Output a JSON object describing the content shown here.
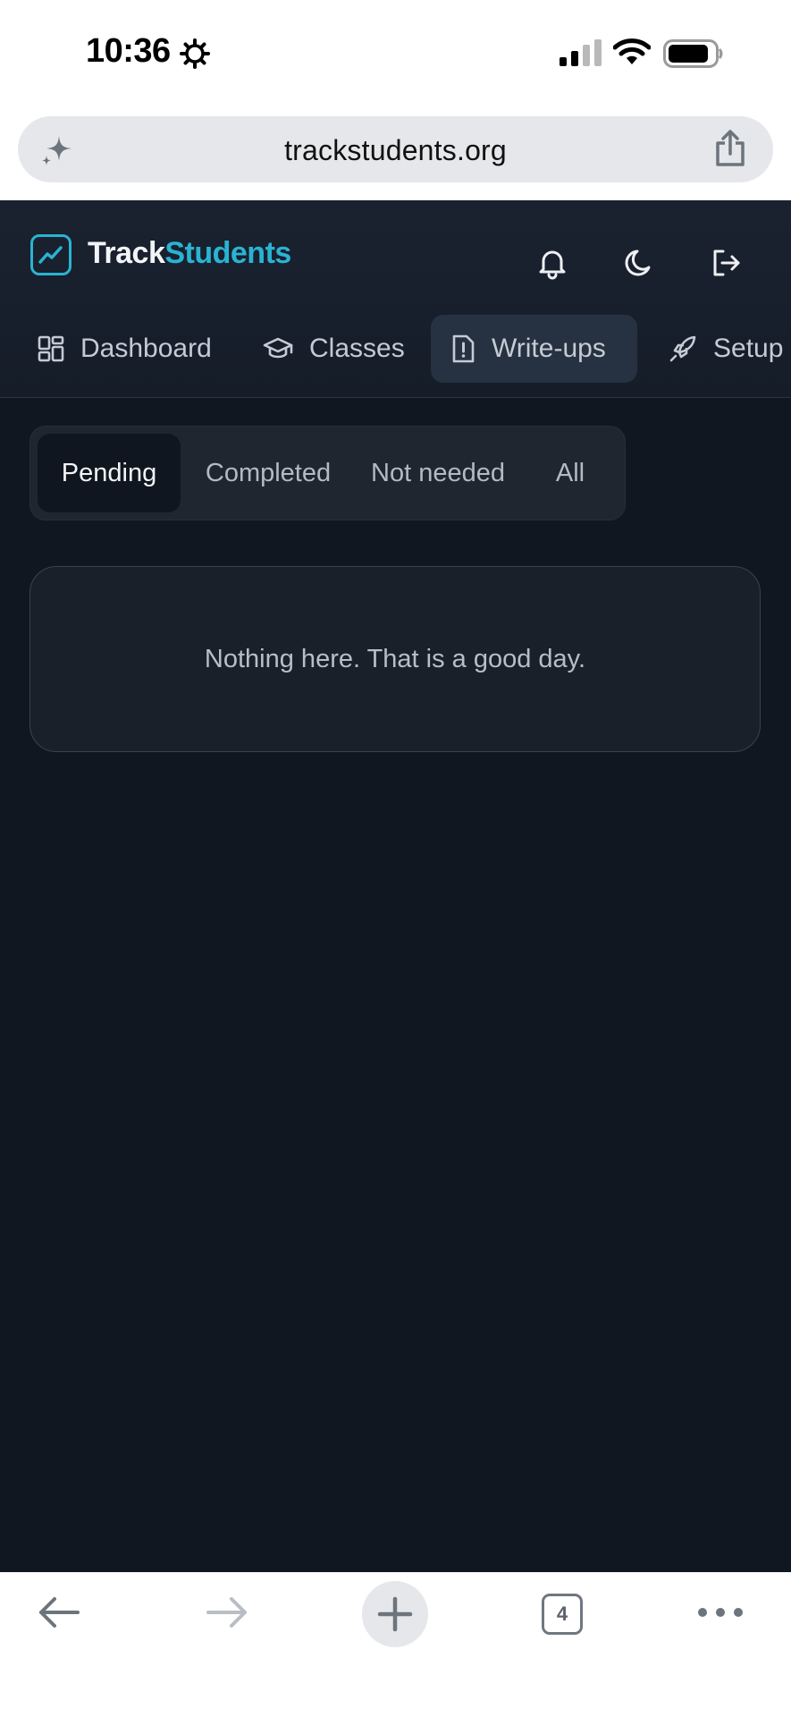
{
  "status_bar": {
    "time": "10:36",
    "icons": [
      "gear-icon",
      "signal-icon",
      "wifi-icon",
      "battery-icon"
    ]
  },
  "browser": {
    "url": "trackstudents.org",
    "icons": [
      "sparkle-icon",
      "share-icon"
    ]
  },
  "app": {
    "brand_part1": "Track",
    "brand_part2": "Students",
    "accent_color": "#2ab3d3",
    "header_icons": [
      "bell-icon",
      "moon-icon",
      "logout-icon"
    ],
    "nav": [
      {
        "label": "Dashboard",
        "icon": "grid-icon",
        "active": false
      },
      {
        "label": "Classes",
        "icon": "graduation-cap-icon",
        "active": false
      },
      {
        "label": "Write-ups",
        "icon": "alert-file-icon",
        "active": true
      },
      {
        "label": "Setup",
        "icon": "rocket-icon",
        "active": false
      }
    ]
  },
  "filters": {
    "tabs": [
      "Pending",
      "Completed",
      "Not needed",
      "All"
    ],
    "selected": "Pending"
  },
  "empty_state": {
    "message": "Nothing here. That is a good day."
  },
  "toolbar": {
    "tab_count": "4",
    "icons": [
      "back-arrow-icon",
      "forward-arrow-icon",
      "plus-icon",
      "tabs-icon",
      "more-icon"
    ]
  }
}
